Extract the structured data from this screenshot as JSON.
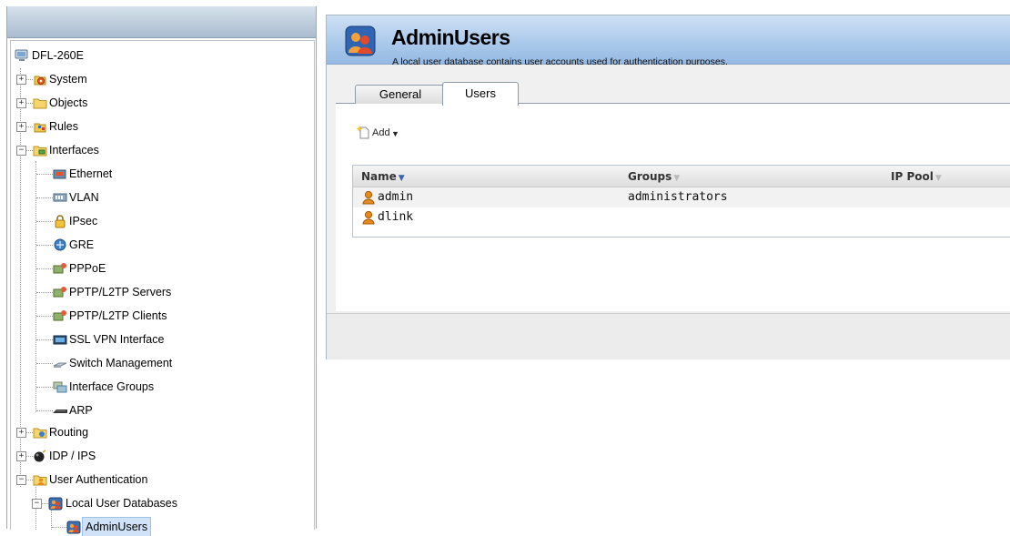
{
  "tree": {
    "root": "DFL-260E",
    "items": [
      {
        "label": "System",
        "icon": "system-icon",
        "state": "collapsed"
      },
      {
        "label": "Objects",
        "icon": "folder-icon",
        "state": "collapsed"
      },
      {
        "label": "Rules",
        "icon": "rules-icon",
        "state": "collapsed"
      },
      {
        "label": "Interfaces",
        "icon": "interfaces-folder-icon",
        "state": "expanded"
      },
      {
        "label": "Ethernet",
        "icon": "ethernet-icon"
      },
      {
        "label": "VLAN",
        "icon": "vlan-icon"
      },
      {
        "label": "IPsec",
        "icon": "lock-icon"
      },
      {
        "label": "GRE",
        "icon": "gre-icon"
      },
      {
        "label": "PPPoE",
        "icon": "pppoe-icon"
      },
      {
        "label": "PPTP/L2TP Servers",
        "icon": "pptp-server-icon"
      },
      {
        "label": "PPTP/L2TP Clients",
        "icon": "pptp-client-icon"
      },
      {
        "label": "SSL VPN Interface",
        "icon": "ssl-vpn-icon"
      },
      {
        "label": "Switch Management",
        "icon": "switch-icon"
      },
      {
        "label": "Interface Groups",
        "icon": "interface-groups-icon"
      },
      {
        "label": "ARP",
        "icon": "arp-icon"
      },
      {
        "label": "Routing",
        "icon": "routing-icon",
        "state": "collapsed"
      },
      {
        "label": "IDP / IPS",
        "icon": "idp-icon",
        "state": "collapsed"
      },
      {
        "label": "User Authentication",
        "icon": "user-auth-icon",
        "state": "expanded"
      },
      {
        "label": "Local User Databases",
        "icon": "user-db-icon",
        "state": "expanded"
      },
      {
        "label": "AdminUsers",
        "icon": "user-db-icon",
        "state": "selected"
      }
    ]
  },
  "header": {
    "title": "AdminUsers",
    "description": "A local user database contains user accounts used for authentication purposes."
  },
  "tabs": [
    {
      "label": "General",
      "active": false
    },
    {
      "label": "Users",
      "active": true
    }
  ],
  "toolbar": {
    "add_label": "Add"
  },
  "table": {
    "columns": [
      "Name",
      "Groups",
      "IP Pool"
    ],
    "rows": [
      {
        "name": "admin",
        "groups": "administrators",
        "ip_pool": ""
      },
      {
        "name": "dlink",
        "groups": "",
        "ip_pool": ""
      }
    ]
  },
  "colors": {
    "header_blue": "#a9c8ea",
    "selection": "#cfe2f7",
    "user_icon_orange": "#e8891a"
  }
}
